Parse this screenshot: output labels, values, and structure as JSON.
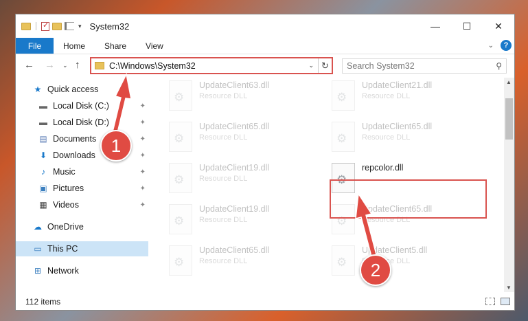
{
  "window": {
    "title": "System32",
    "controls": {
      "minimize": "—",
      "maximize": "☐",
      "close": "✕"
    }
  },
  "ribbon": {
    "tabs": [
      "File",
      "Home",
      "Share",
      "View"
    ]
  },
  "address": {
    "path": "C:\\Windows\\System32",
    "search_placeholder": "Search System32"
  },
  "sidebar": {
    "items": [
      {
        "label": "Quick access",
        "icon": "star-icon",
        "pinned": false
      },
      {
        "label": "Local Disk (C:)",
        "icon": "drive-icon",
        "pinned": true
      },
      {
        "label": "Local Disk (D:)",
        "icon": "drive-icon",
        "pinned": true
      },
      {
        "label": "Documents",
        "icon": "documents-icon",
        "pinned": true
      },
      {
        "label": "Downloads",
        "icon": "download-icon",
        "pinned": true
      },
      {
        "label": "Music",
        "icon": "music-icon",
        "pinned": true
      },
      {
        "label": "Pictures",
        "icon": "pictures-icon",
        "pinned": true
      },
      {
        "label": "Videos",
        "icon": "videos-icon",
        "pinned": true
      },
      {
        "label": "OneDrive",
        "icon": "cloud-icon",
        "pinned": false
      },
      {
        "label": "This PC",
        "icon": "computer-icon",
        "pinned": false,
        "selected": true
      },
      {
        "label": "Network",
        "icon": "network-icon",
        "pinned": false
      }
    ]
  },
  "files": [
    {
      "name": "UpdateClient63.dll",
      "type": "Resource DLL"
    },
    {
      "name": "UpdateClient21.dll",
      "type": "Resource DLL"
    },
    {
      "name": "UpdateClient65.dll",
      "type": "Resource DLL"
    },
    {
      "name": "UpdateClient65.dll",
      "type": "Resource DLL"
    },
    {
      "name": "UpdateClient19.dll",
      "type": "Resource DLL"
    },
    {
      "name": "repcolor.dll",
      "type": ""
    },
    {
      "name": "UpdateClient19.dll",
      "type": "Resource DLL"
    },
    {
      "name": "UpdateClient65.dll",
      "type": "Resource DLL"
    },
    {
      "name": "UpdateClient65.dll",
      "type": "Resource DLL"
    },
    {
      "name": "UpdateClient5.dll",
      "type": "Resource DLL"
    }
  ],
  "status": {
    "items_count": "112 items"
  },
  "annotations": {
    "step1": "1",
    "step2": "2",
    "color": "#e04b43"
  }
}
